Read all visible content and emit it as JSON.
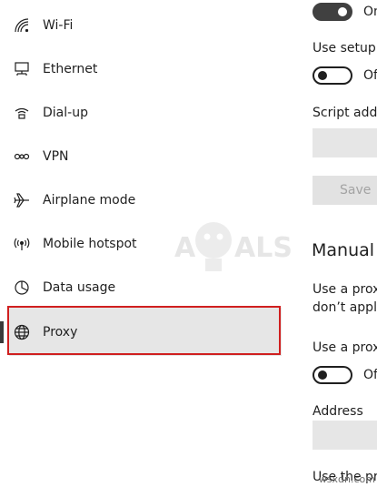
{
  "nav": {
    "items": [
      {
        "label": "Wi-Fi",
        "icon": "wifi-icon"
      },
      {
        "label": "Ethernet",
        "icon": "ethernet-icon"
      },
      {
        "label": "Dial-up",
        "icon": "dialup-icon"
      },
      {
        "label": "VPN",
        "icon": "vpn-icon"
      },
      {
        "label": "Airplane mode",
        "icon": "airplane-icon"
      },
      {
        "label": "Mobile hotspot",
        "icon": "hotspot-icon"
      },
      {
        "label": "Data usage",
        "icon": "data-usage-icon"
      },
      {
        "label": "Proxy",
        "icon": "globe-icon"
      }
    ],
    "selected": "Proxy"
  },
  "watermark": {
    "logo_text": "APPUALS",
    "site": "wsxdn.com"
  },
  "automatic": {
    "detect_toggle": {
      "state": "on",
      "label": "On"
    },
    "setup_script_label": "Use setup s",
    "setup_script_toggle": {
      "state": "off",
      "label": "Of"
    },
    "script_address_label": "Script addr",
    "save_label": "Save"
  },
  "manual": {
    "heading": "Manual",
    "description_line1": "Use a proxy",
    "description_line2": "don’t apply",
    "use_proxy_label": "Use a proxy",
    "use_proxy_toggle": {
      "state": "off",
      "label": "Of"
    },
    "address_label": "Address",
    "bottom_label": "Use the pro"
  },
  "colors": {
    "highlight": "#d01f1f",
    "selected_bg": "#e6e6e6",
    "toggle_on": "#404040"
  }
}
